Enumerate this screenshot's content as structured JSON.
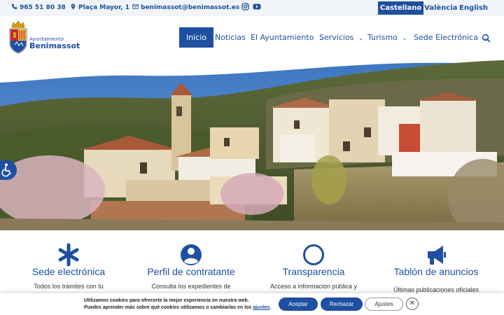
{
  "topbar": {
    "phone": "965 51 80 38",
    "address": "Plaça Mayor, 1",
    "email": "benimassot@benimassot.es",
    "social_icons": [
      "instagram-icon",
      "youtube-icon"
    ],
    "languages": [
      {
        "label": "Castellano",
        "active": true
      },
      {
        "label": "València",
        "active": false
      },
      {
        "label": "English",
        "active": false
      }
    ]
  },
  "header": {
    "logo_line1": "Ayuntamiento",
    "logo_line2": "Benimassot",
    "nav": [
      {
        "label": "Inicio",
        "active": true,
        "dropdown": false
      },
      {
        "label": "Noticias",
        "active": false,
        "dropdown": false
      },
      {
        "label": "El Ayuntamiento",
        "active": false,
        "dropdown": true
      },
      {
        "label": "Servicios",
        "active": false,
        "dropdown": true
      },
      {
        "label": "Turismo",
        "active": false,
        "dropdown": true
      },
      {
        "label": "Sede Electrónica",
        "active": false,
        "dropdown": true
      }
    ],
    "search_icon": "search-icon"
  },
  "hero": {
    "accessibility_icon": "wheelchair-icon"
  },
  "cards": [
    {
      "title": "Sede electrónica",
      "desc": "Todos los trámites con tu",
      "icon": "asterisk-icon"
    },
    {
      "title": "Perfil de contratante",
      "desc": "Consulta los expedientes de",
      "icon": "user-circle-icon"
    },
    {
      "title": "Transparencia",
      "desc": "Acceso a información pública y",
      "icon": "circle-icon"
    },
    {
      "title": "Tablón de anuncios",
      "desc": "Últimas publicaciones oficiales",
      "icon": "megaphone-icon"
    }
  ],
  "cookie": {
    "line1": "Utilizamos cookies para ofrecerte la mejor experiencia en nuestra web.",
    "line2_prefix": "Puedes aprender más sobre qué cookies utilizamos o cambiarlas en los ",
    "line2_link": "ajustes",
    "line2_suffix": ".",
    "accept": "Aceptar",
    "reject": "Rechazar",
    "settings": "Ajustes",
    "close_icon": "close-icon"
  },
  "colors": {
    "brand": "#1f4fa0",
    "topbar_bg": "#f1f4f8"
  }
}
